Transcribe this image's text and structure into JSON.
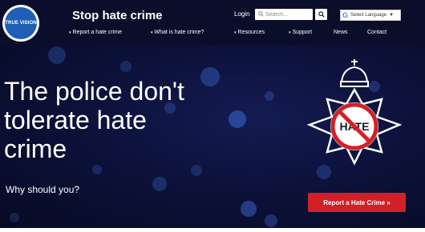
{
  "header": {
    "logo_text": "TRUE VISION",
    "site_title": "Stop hate crime",
    "login_label": "Login",
    "search": {
      "placeholder": "Search...",
      "value": ""
    },
    "language": {
      "g_label": "G",
      "label": "Select Language",
      "caret": "▼"
    }
  },
  "nav": {
    "items": [
      {
        "label": "Report a hate crime",
        "has_dropdown": true
      },
      {
        "label": "What is hate crime?",
        "has_dropdown": true
      },
      {
        "label": "Resources",
        "has_dropdown": true
      },
      {
        "label": "Support",
        "has_dropdown": true
      },
      {
        "label": "News",
        "has_dropdown": false
      },
      {
        "label": "Contact",
        "has_dropdown": false
      }
    ],
    "caret": "▾"
  },
  "hero": {
    "headline_lines": [
      "The police don't",
      "tolerate hate",
      "crime"
    ],
    "subline": "Why should you?",
    "badge_text": "HATE",
    "cta_label": "Report a Hate Crime »"
  },
  "colors": {
    "header_bg": "#0b0e2b",
    "hero_bg": "#0b1036",
    "bokeh": "#3a63c7",
    "cta": "#d32027",
    "badge_ring": "#d32027",
    "logo_blue": "#1f5fb5"
  },
  "icons": [
    "search-icon",
    "google-g-icon",
    "crown-icon",
    "police-star-icon",
    "no-symbol-icon"
  ]
}
